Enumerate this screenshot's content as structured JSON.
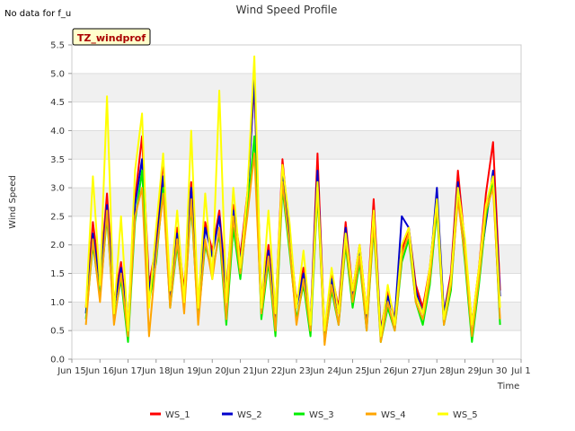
{
  "chart_data": {
    "type": "line",
    "title": "Wind Speed Profile",
    "corner_note": "No data for f_u",
    "site_label": "TZ_windprof",
    "xlabel": "Time",
    "ylabel": "Wind Speed",
    "xlim": [
      15,
      31
    ],
    "ylim": [
      0.0,
      5.5
    ],
    "yticks": [
      "0.0",
      "0.5",
      "1.0",
      "1.5",
      "2.0",
      "2.5",
      "3.0",
      "3.5",
      "4.0",
      "4.5",
      "5.0",
      "5.5"
    ],
    "xticks": [
      {
        "day": 15,
        "label": "Jun 15"
      },
      {
        "day": 16,
        "label": "Jun 16"
      },
      {
        "day": 17,
        "label": "Jun 17"
      },
      {
        "day": 18,
        "label": "Jun 18"
      },
      {
        "day": 19,
        "label": "Jun 19"
      },
      {
        "day": 20,
        "label": "Jun 20"
      },
      {
        "day": 21,
        "label": "Jun 21"
      },
      {
        "day": 22,
        "label": "Jun 22"
      },
      {
        "day": 23,
        "label": "Jun 23"
      },
      {
        "day": 24,
        "label": "Jun 24"
      },
      {
        "day": 25,
        "label": "Jun 25"
      },
      {
        "day": 26,
        "label": "Jun 26"
      },
      {
        "day": 27,
        "label": "Jun 27"
      },
      {
        "day": 28,
        "label": "Jun 28"
      },
      {
        "day": 29,
        "label": "Jun 29"
      },
      {
        "day": 30,
        "label": "Jun 30"
      },
      {
        "day": 31,
        "label": "Jul 1"
      }
    ],
    "grid": true,
    "legend_position": "bottom",
    "x": [
      15.5,
      15.75,
      16.0,
      16.25,
      16.5,
      16.75,
      17.0,
      17.25,
      17.5,
      17.75,
      18.0,
      18.25,
      18.5,
      18.75,
      19.0,
      19.25,
      19.5,
      19.75,
      20.0,
      20.25,
      20.5,
      20.75,
      21.0,
      21.25,
      21.5,
      21.75,
      22.0,
      22.25,
      22.5,
      22.75,
      23.0,
      23.25,
      23.5,
      23.75,
      24.0,
      24.25,
      24.5,
      24.75,
      25.0,
      25.25,
      25.5,
      25.75,
      26.0,
      26.25,
      26.5,
      26.75,
      27.0,
      27.25,
      27.5,
      27.75,
      28.0,
      28.25,
      28.5,
      28.75,
      29.0,
      29.25,
      29.5,
      29.75,
      30.0,
      30.25
    ],
    "series": [
      {
        "name": "WS_1",
        "color": "#ff0000",
        "values": [
          0.9,
          2.4,
          1.4,
          2.9,
          1.0,
          1.7,
          0.6,
          2.8,
          3.9,
          1.3,
          2.0,
          3.5,
          1.1,
          2.3,
          1.2,
          3.1,
          1.0,
          2.4,
          1.9,
          2.6,
          1.2,
          2.7,
          1.8,
          2.9,
          4.8,
          1.0,
          2.0,
          0.8,
          3.5,
          2.2,
          1.0,
          1.6,
          0.6,
          3.6,
          0.4,
          1.5,
          0.9,
          2.4,
          1.2,
          2.0,
          0.8,
          2.8,
          0.5,
          1.2,
          0.7,
          1.9,
          2.3,
          1.3,
          0.9,
          1.6,
          2.8,
          0.8,
          1.5,
          3.3,
          2.0,
          0.6,
          1.6,
          2.9,
          3.8,
          1.2
        ]
      },
      {
        "name": "WS_2",
        "color": "#0000cc",
        "values": [
          0.8,
          2.2,
          1.3,
          2.7,
          0.9,
          1.6,
          0.6,
          2.7,
          3.5,
          1.2,
          1.9,
          3.2,
          1.0,
          2.2,
          1.1,
          3.0,
          0.9,
          2.3,
          1.8,
          2.5,
          1.1,
          2.6,
          1.7,
          2.8,
          4.9,
          0.9,
          1.9,
          0.7,
          3.2,
          2.1,
          0.9,
          1.5,
          0.6,
          3.3,
          0.4,
          1.4,
          0.8,
          2.3,
          1.1,
          1.9,
          0.7,
          2.6,
          0.5,
          1.1,
          0.7,
          2.5,
          2.3,
          1.2,
          0.8,
          1.5,
          3.0,
          0.8,
          1.4,
          3.1,
          1.9,
          0.6,
          1.5,
          2.4,
          3.3,
          1.1
        ]
      },
      {
        "name": "WS_3",
        "color": "#00ee00",
        "values": [
          0.7,
          2.0,
          1.1,
          2.5,
          0.7,
          1.4,
          0.3,
          2.4,
          3.3,
          1.0,
          1.7,
          3.0,
          0.9,
          2.0,
          0.9,
          2.7,
          0.7,
          2.0,
          1.5,
          2.2,
          0.6,
          2.3,
          1.4,
          2.6,
          3.9,
          0.7,
          1.7,
          0.4,
          3.0,
          1.9,
          0.7,
          1.3,
          0.4,
          2.9,
          0.3,
          1.2,
          0.6,
          2.0,
          0.9,
          1.7,
          0.5,
          2.3,
          0.3,
          0.9,
          0.5,
          1.7,
          2.1,
          1.0,
          0.6,
          1.3,
          2.6,
          0.6,
          1.2,
          2.9,
          1.7,
          0.3,
          1.3,
          2.5,
          3.1,
          0.6
        ]
      },
      {
        "name": "WS_4",
        "color": "#ffa500",
        "values": [
          0.6,
          2.1,
          1.0,
          2.6,
          0.6,
          1.5,
          0.4,
          2.5,
          3.0,
          0.4,
          1.8,
          2.9,
          0.9,
          2.1,
          0.8,
          2.8,
          0.6,
          2.1,
          1.4,
          2.3,
          0.7,
          2.5,
          1.5,
          2.5,
          3.6,
          0.8,
          1.8,
          0.5,
          3.1,
          2.0,
          0.6,
          1.4,
          0.5,
          3.0,
          0.25,
          1.3,
          0.6,
          2.1,
          1.0,
          1.8,
          0.5,
          2.4,
          0.3,
          1.0,
          0.5,
          1.8,
          2.2,
          1.0,
          0.7,
          1.4,
          2.7,
          0.6,
          1.3,
          2.8,
          1.8,
          0.4,
          1.4,
          2.6,
          3.0,
          0.7
        ]
      },
      {
        "name": "WS_5",
        "color": "#ffff00",
        "values": [
          0.9,
          3.2,
          1.3,
          4.6,
          0.8,
          2.5,
          0.5,
          3.3,
          4.3,
          0.9,
          2.3,
          3.6,
          1.2,
          2.6,
          1.0,
          4.0,
          0.9,
          2.9,
          1.4,
          4.7,
          1.0,
          3.0,
          1.6,
          2.9,
          5.3,
          0.9,
          2.6,
          0.8,
          3.4,
          2.4,
          0.9,
          1.9,
          0.6,
          3.1,
          0.5,
          1.6,
          0.8,
          2.2,
          1.2,
          2.0,
          0.8,
          2.6,
          0.4,
          1.3,
          0.6,
          2.0,
          2.3,
          1.1,
          0.8,
          1.6,
          2.8,
          0.7,
          1.4,
          3.0,
          2.1,
          0.6,
          1.6,
          2.7,
          3.2,
          0.9
        ]
      }
    ]
  }
}
